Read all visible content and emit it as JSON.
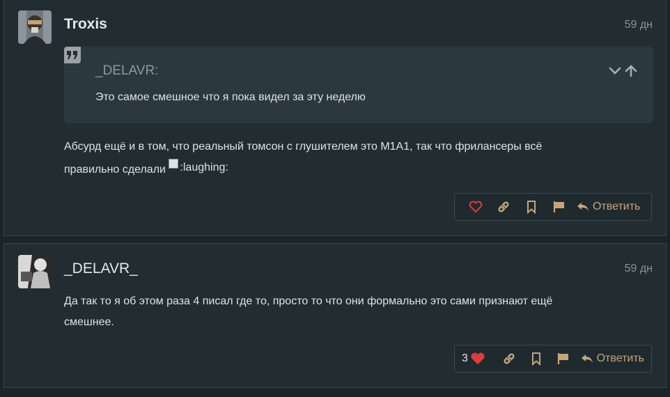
{
  "posts": [
    {
      "author": "Troxis",
      "time": "59 дн",
      "quote": {
        "author": "_DELAVR:",
        "text": "Это самое смешное что я пока видел за эту неделю"
      },
      "body_line1": "Абсурд ещё и в том, что реальный томсон с глушителем это M1A1, так что фрилансеры всё",
      "body_line2": "правильно сделали",
      "smiley_alt": ":laughing:",
      "reply_label": "Ответить"
    },
    {
      "author": "_DELAVR_",
      "time": "59 дн",
      "body_line1": "Да так то я об этом раза 4 писал где то, просто то что они формально это сами признают ещё",
      "body_line2": "смешнее.",
      "like_count": "3",
      "reply_label": "Ответить"
    }
  ],
  "colors": {
    "accent": "#c6a679",
    "like_active": "#e03b3b",
    "panel": "#222d31",
    "quote_bg": "#2b383d"
  },
  "icons": [
    "heart-icon",
    "link-icon",
    "bookmark-icon",
    "flag-icon",
    "reply-arrow-icon",
    "chevron-down-icon",
    "arrow-up-icon",
    "quote-icon"
  ]
}
